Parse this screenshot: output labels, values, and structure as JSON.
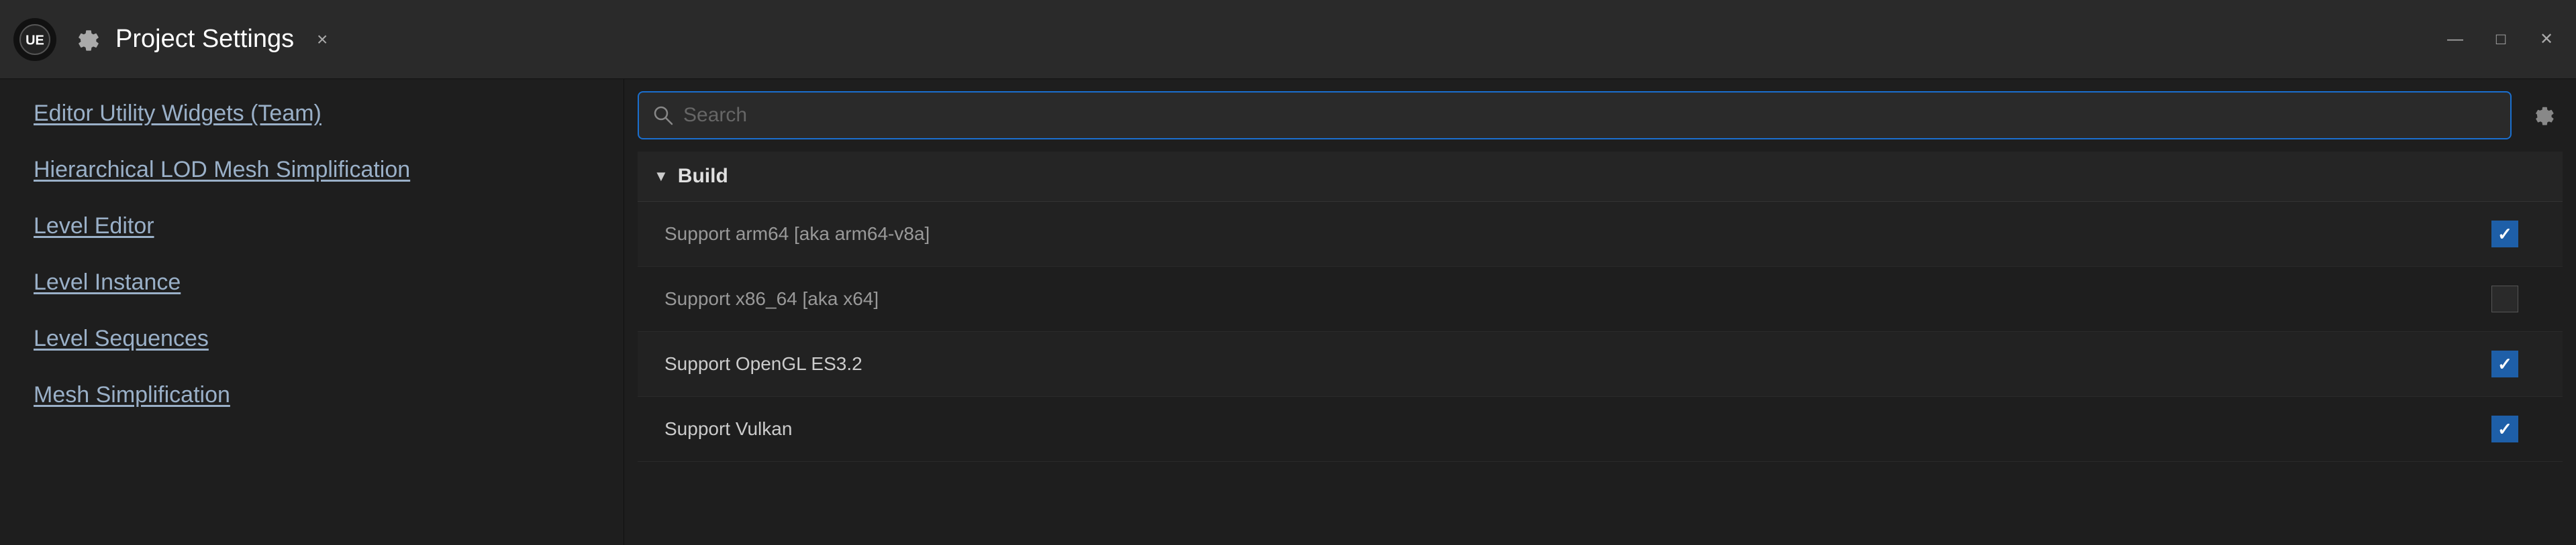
{
  "titleBar": {
    "title": "Project Settings",
    "closeLabel": "×",
    "minimizeLabel": "—",
    "maximizeLabel": "□",
    "closeWindowLabel": "✕"
  },
  "sidebar": {
    "items": [
      {
        "label": "Editor Utility Widgets (Team)",
        "id": "editor-utility-widgets"
      },
      {
        "label": "Hierarchical LOD Mesh Simplification",
        "id": "hierarchical-lod"
      },
      {
        "label": "Level Editor",
        "id": "level-editor"
      },
      {
        "label": "Level Instance",
        "id": "level-instance"
      },
      {
        "label": "Level Sequences",
        "id": "level-sequences"
      },
      {
        "label": "Mesh Simplification",
        "id": "mesh-simplification"
      }
    ]
  },
  "searchBar": {
    "placeholder": "Search"
  },
  "buildSection": {
    "title": "Build",
    "arrowSymbol": "▼",
    "rows": [
      {
        "label": "Support arm64 [aka arm64-v8a]",
        "checked": true,
        "dimmed": true
      },
      {
        "label": "Support x86_64 [aka x64]",
        "checked": false,
        "dimmed": true
      },
      {
        "label": "Support OpenGL ES3.2",
        "checked": true,
        "dimmed": false
      },
      {
        "label": "Support Vulkan",
        "checked": true,
        "dimmed": false
      }
    ]
  }
}
